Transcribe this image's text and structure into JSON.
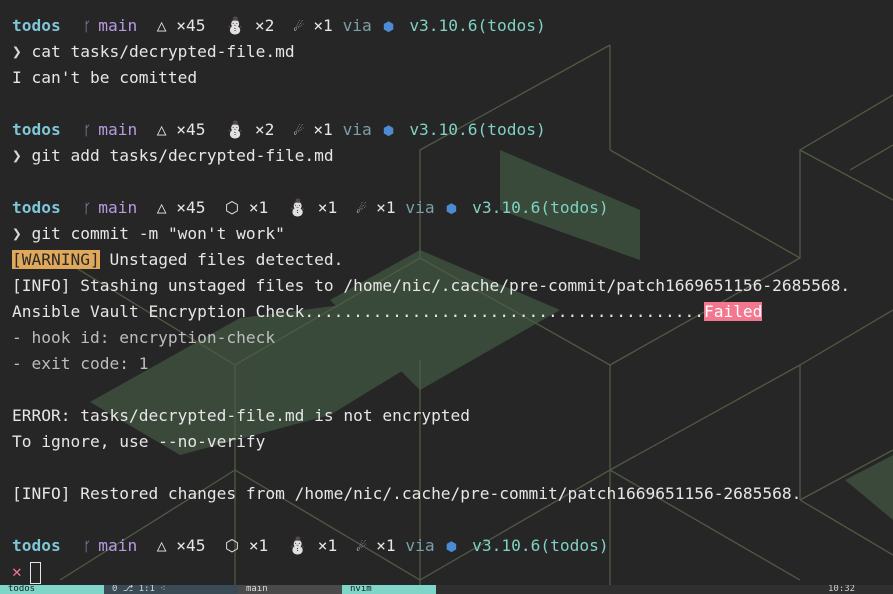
{
  "colors": {
    "background": "#262626",
    "hex_fill": "#3f5140",
    "hex_line": "#4f5a43",
    "accent": "#7fc6d9",
    "warn": "#e0a85a",
    "fail": "#f2778f"
  },
  "prompt": {
    "dir": "todos",
    "branch_icon": "git-branch-icon",
    "branch": "main",
    "python_icon": "python-icon",
    "via": "via",
    "python_version": "v3.10.6(todos)",
    "chevron": "❯",
    "error_mark": "✕"
  },
  "blocks": [
    {
      "prompt_status": "△ ×45  ⛄ ×2  ☄ ×1",
      "command": "cat tasks/decrypted-file.md",
      "output": [
        "I can't be comitted"
      ]
    },
    {
      "prompt_status": "△ ×45  ⛄ ×2  ☄ ×1",
      "command": "git add tasks/decrypted-file.md",
      "output": []
    },
    {
      "prompt_status": "△ ×45  ⬡ ×1  ⛄ ×1  ☄ ×1",
      "command": "git commit -m \"won't work\"",
      "warning_tag": "[WARNING]",
      "warning_text": " Unstaged files detected.",
      "info_stash": "[INFO] Stashing unstaged files to /home/nic/.cache/pre-commit/patch1669651156-2685568.",
      "check_name": "Ansible Vault Encryption Check.........................................",
      "check_result": "Failed",
      "hook_id": "- hook id: encryption-check",
      "exit_code": "- exit code: 1",
      "error_line": "ERROR: tasks/decrypted-file.md is not encrypted",
      "ignore_line": "To ignore, use --no-verify",
      "info_restore": "[INFO] Restored changes from /home/nic/.cache/pre-commit/patch1669651156-2685568."
    }
  ],
  "final_prompt_status": "△ ×45  ⬡ ×1  ⛄ ×1  ☄ ×1",
  "statusbar": {
    "seg1": "todos",
    "seg2": "0 ⎇ 1:1 ⁖",
    "seg3": "main",
    "seg4": "nvim",
    "clock": "10:32"
  }
}
